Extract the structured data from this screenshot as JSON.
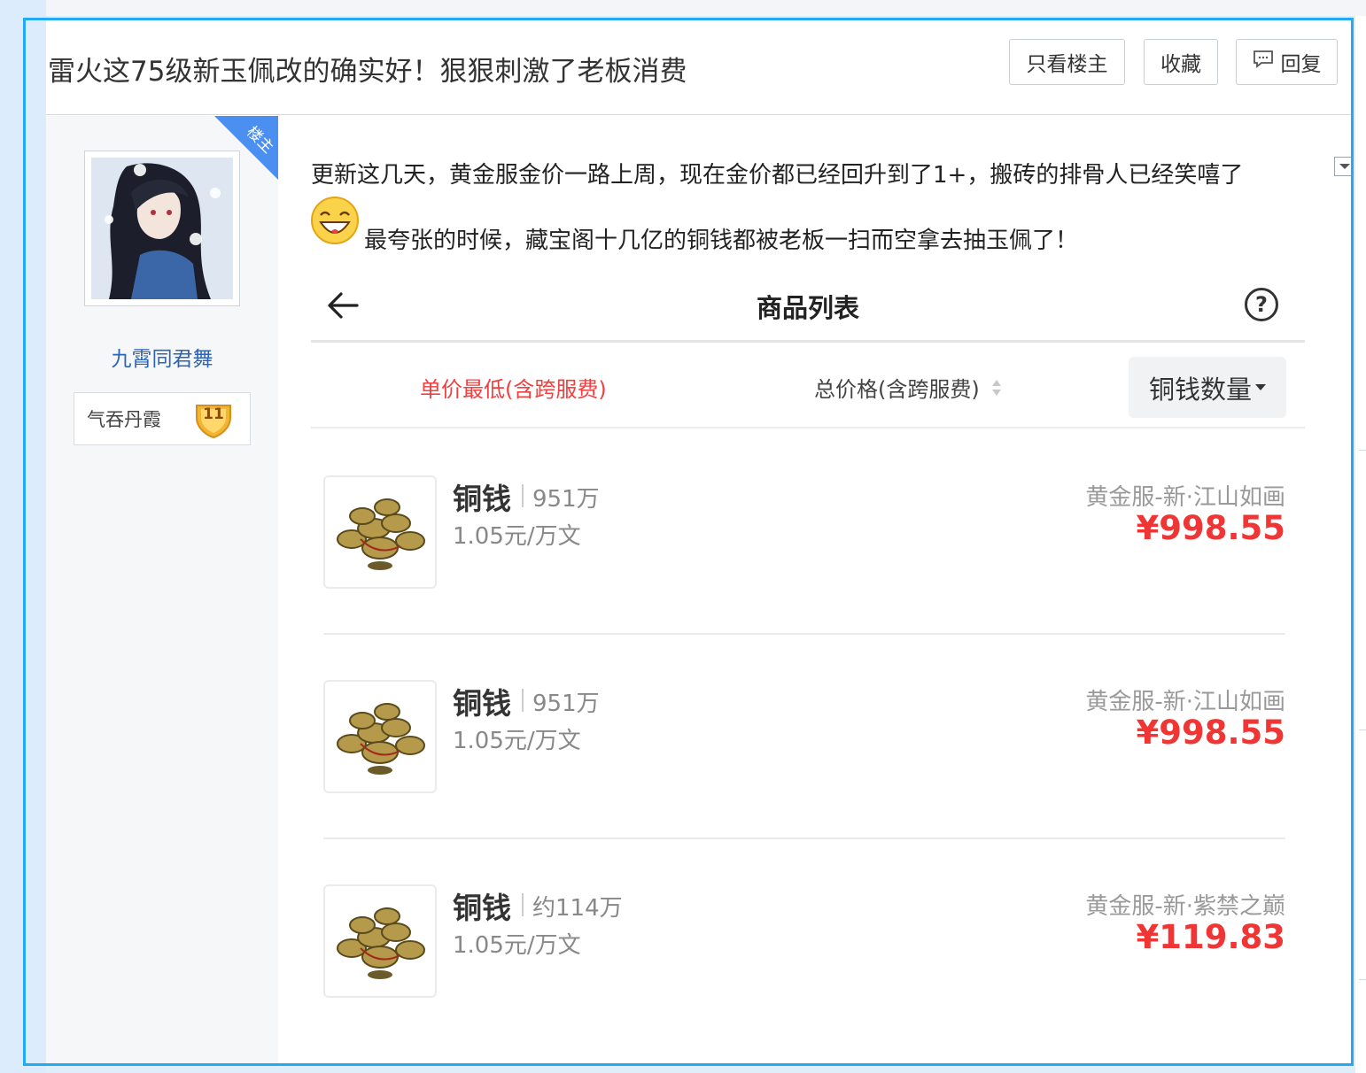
{
  "thread": {
    "title": "雷火这75级新玉佩改的确实好！狠狠刺激了老板消费",
    "buttons": {
      "only_op": "只看楼主",
      "favorite": "收藏",
      "reply": "回复"
    }
  },
  "author": {
    "op_tag": "楼主",
    "username": "九霄同君舞",
    "badge_title": "气吞丹霞",
    "level": "11"
  },
  "post": {
    "line1": "更新这几天，黄金服金价一路上周，现在金价都已经回升到了1+，搬砖的排骨人已经笑嘻了",
    "line2": "最夸张的时候，藏宝阁十几亿的铜钱都被老板一扫而空拿去抽玉佩了！",
    "emoji": "laughing-face"
  },
  "screenshot": {
    "title": "商品列表",
    "help": "?",
    "sort": {
      "unit_price": "单价最低(含跨服费)",
      "total_price": "总价格(含跨服费)",
      "coin_amount": "铜钱数量"
    },
    "items": [
      {
        "name": "铜钱",
        "qty": "951万",
        "unit": "1.05元/万文",
        "server": "黄金服-新·江山如画",
        "price": "¥998.55"
      },
      {
        "name": "铜钱",
        "qty": "951万",
        "unit": "1.05元/万文",
        "server": "黄金服-新·江山如画",
        "price": "¥998.55"
      },
      {
        "name": "铜钱",
        "qty": "约114万",
        "unit": "1.05元/万文",
        "server": "黄金服-新·紫禁之巅",
        "price": "¥119.83"
      }
    ]
  },
  "colors": {
    "frame": "#24aaf2",
    "username": "#2d64b3",
    "price": "#f03535",
    "active_sort": "#f04040",
    "op_tag": "#4b90f0"
  }
}
